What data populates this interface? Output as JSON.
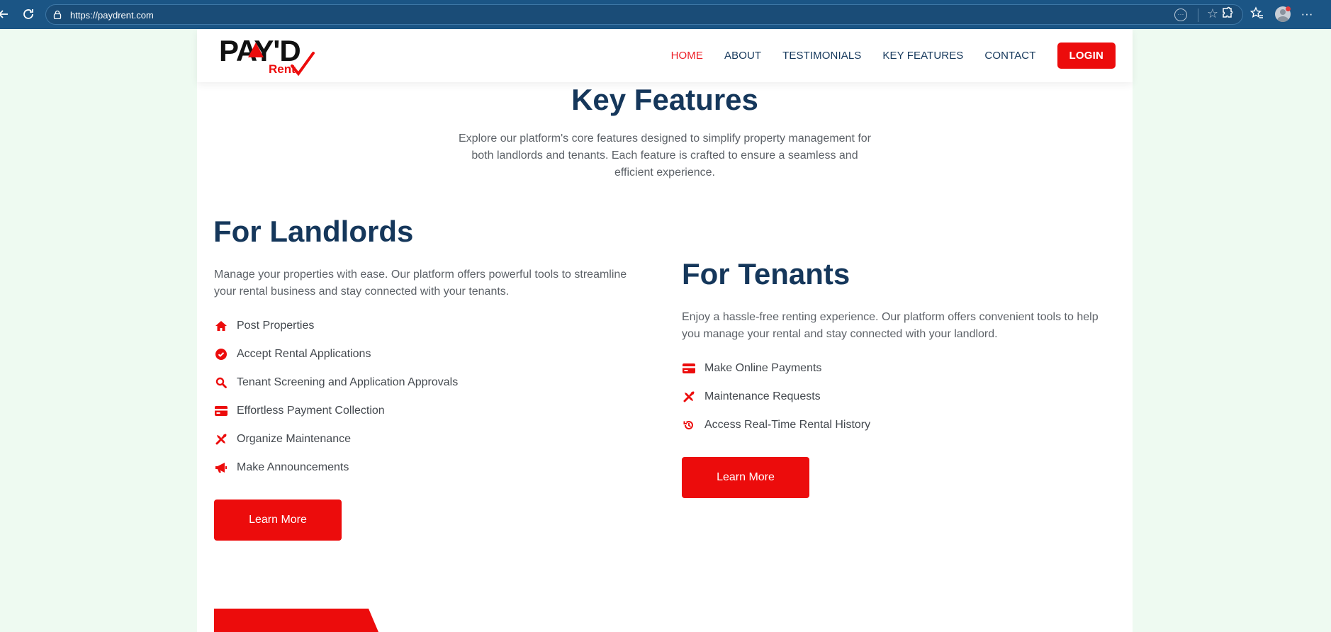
{
  "browser": {
    "url": "https://paydrent.com"
  },
  "header": {
    "logo_text": "PAY'D",
    "logo_sub": "Rent",
    "nav": [
      {
        "label": "HOME"
      },
      {
        "label": "ABOUT"
      },
      {
        "label": "TESTIMONIALS"
      },
      {
        "label": "KEY FEATURES"
      },
      {
        "label": "CONTACT"
      }
    ],
    "login_label": "LOGIN"
  },
  "section": {
    "title": "Key Features",
    "intro": "Explore our platform's core features designed to simplify property management for both landlords and tenants. Each feature is crafted to ensure a seamless and efficient experience."
  },
  "landlords": {
    "title": "For Landlords",
    "description": "Manage your properties with ease. Our platform offers powerful tools to streamline your rental business and stay connected with your tenants.",
    "features": [
      {
        "icon": "home-icon",
        "label": "Post Properties"
      },
      {
        "icon": "check-circle-icon",
        "label": "Accept Rental Applications"
      },
      {
        "icon": "search-icon",
        "label": "Tenant Screening and Application Approvals"
      },
      {
        "icon": "credit-card-icon",
        "label": "Effortless Payment Collection"
      },
      {
        "icon": "tools-icon",
        "label": "Organize Maintenance"
      },
      {
        "icon": "megaphone-icon",
        "label": "Make Announcements"
      }
    ],
    "button_label": "Learn More"
  },
  "tenants": {
    "title": "For Tenants",
    "description": "Enjoy a hassle-free renting experience. Our platform offers convenient tools to help you manage your rental and stay connected with your landlord.",
    "features": [
      {
        "icon": "credit-card-icon",
        "label": "Make Online Payments"
      },
      {
        "icon": "tools-icon",
        "label": "Maintenance Requests"
      },
      {
        "icon": "history-icon",
        "label": "Access Real-Time Rental History"
      }
    ],
    "button_label": "Learn More"
  },
  "colors": {
    "accent": "#ec0c0c",
    "heading": "#15375b",
    "chrome": "#1b5585"
  }
}
